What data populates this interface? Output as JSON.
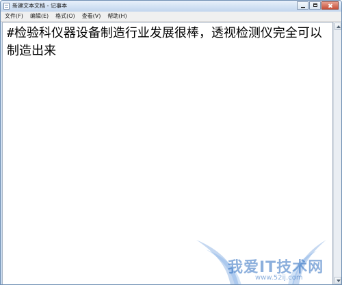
{
  "window": {
    "title": "新建文本文档 - 记事本"
  },
  "menubar": {
    "items": [
      {
        "label": "文件(F)"
      },
      {
        "label": "编辑(E)"
      },
      {
        "label": "格式(O)"
      },
      {
        "label": "查看(V)"
      },
      {
        "label": "帮助(H)"
      }
    ]
  },
  "editor": {
    "content": "#检验科仪器设备制造行业发展很棒，透视检测仪完全可以制造出来"
  },
  "watermark": {
    "brand": "我爱IT技术网",
    "url": "www.52ij.com"
  },
  "colors": {
    "titlebar": "#d4e3f4",
    "menubar": "#f0f0f0",
    "editor_bg": "#ffffff",
    "watermark": "#2f6fc0"
  },
  "icons": [
    "notepad-icon",
    "minimize-icon",
    "maximize-icon",
    "close-icon",
    "scroll-up-icon",
    "scroll-down-icon",
    "wing-logo-icon"
  ]
}
